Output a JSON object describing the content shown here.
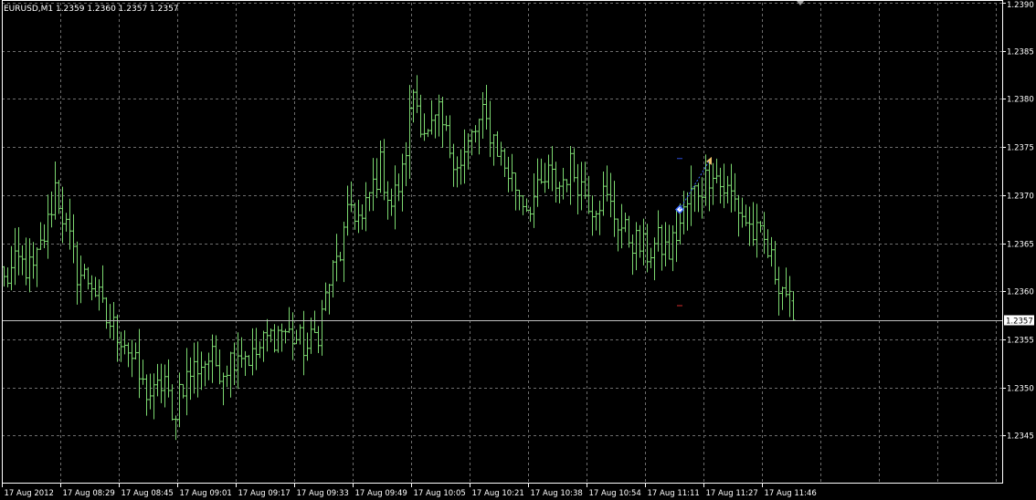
{
  "window": {
    "title": "EURUSD,M1  1.2359 1.2360 1.2357 1.2357"
  },
  "colors": {
    "background": "#000000",
    "grid": "#6e6e6e",
    "bars": "#7cd870",
    "text": "#ffffff",
    "current_line": "#c0c0c0"
  },
  "chart_data": {
    "type": "ohlc",
    "symbol": "EURUSD",
    "timeframe": "M1",
    "title": "EURUSD,M1  1.2359 1.2360 1.2357 1.2357",
    "last_ohlc": {
      "open": 1.2359,
      "high": 1.236,
      "low": 1.2357,
      "close": 1.2357
    },
    "current_price": 1.2357,
    "current_price_label": "1.2357",
    "ylim": [
      1.234,
      1.239
    ],
    "y_ticks": [
      "1.2390",
      "1.2385",
      "1.2380",
      "1.2375",
      "1.2370",
      "1.2365",
      "1.2360",
      "1.2355",
      "1.2350",
      "1.2345"
    ],
    "x_ticks": [
      "17 Aug 2012",
      "17 Aug 08:29",
      "17 Aug 08:45",
      "17 Aug 09:01",
      "17 Aug 09:17",
      "17 Aug 09:33",
      "17 Aug 09:49",
      "17 Aug 10:05",
      "17 Aug 10:21",
      "17 Aug 10:38",
      "17 Aug 10:54",
      "17 Aug 11:11",
      "17 Aug 11:27",
      "17 Aug 11:46"
    ],
    "grid": true,
    "bar_count": 217,
    "close_path": [
      [
        0,
        1.2361
      ],
      [
        4,
        1.2363
      ],
      [
        8,
        1.2362
      ],
      [
        12,
        1.2367
      ],
      [
        14,
        1.2371
      ],
      [
        16,
        1.2368
      ],
      [
        18,
        1.2365
      ],
      [
        20,
        1.2362
      ],
      [
        24,
        1.2361
      ],
      [
        28,
        1.2357
      ],
      [
        33,
        1.2355
      ],
      [
        36,
        1.2352
      ],
      [
        38,
        1.235
      ],
      [
        41,
        1.2349
      ],
      [
        44,
        1.2351
      ],
      [
        46,
        1.2346
      ],
      [
        48,
        1.235
      ],
      [
        52,
        1.2352
      ],
      [
        56,
        1.2353
      ],
      [
        60,
        1.2352
      ],
      [
        64,
        1.2354
      ],
      [
        68,
        1.2353
      ],
      [
        72,
        1.2355
      ],
      [
        76,
        1.2356
      ],
      [
        80,
        1.2355
      ],
      [
        83,
        1.2354
      ],
      [
        86,
        1.2356
      ],
      [
        89,
        1.2361
      ],
      [
        92,
        1.2364
      ],
      [
        95,
        1.2369
      ],
      [
        98,
        1.2367
      ],
      [
        100,
        1.237
      ],
      [
        103,
        1.2373
      ],
      [
        106,
        1.2369
      ],
      [
        109,
        1.2372
      ],
      [
        112,
        1.2381
      ],
      [
        114,
        1.2378
      ],
      [
        116,
        1.2376
      ],
      [
        119,
        1.2378
      ],
      [
        122,
        1.2375
      ],
      [
        125,
        1.2373
      ],
      [
        128,
        1.2376
      ],
      [
        131,
        1.2378
      ],
      [
        134,
        1.2376
      ],
      [
        137,
        1.2373
      ],
      [
        140,
        1.2371
      ],
      [
        143,
        1.2369
      ],
      [
        146,
        1.237
      ],
      [
        149,
        1.2372
      ],
      [
        152,
        1.2371
      ],
      [
        155,
        1.2373
      ],
      [
        158,
        1.2371
      ],
      [
        161,
        1.2369
      ],
      [
        164,
        1.237
      ],
      [
        167,
        1.2368
      ],
      [
        170,
        1.2366
      ],
      [
        173,
        1.2365
      ],
      [
        176,
        1.2364
      ],
      [
        179,
        1.2365
      ],
      [
        182,
        1.2364
      ],
      [
        185,
        1.2367
      ],
      [
        188,
        1.237
      ],
      [
        191,
        1.2371
      ],
      [
        194,
        1.2373
      ],
      [
        196,
        1.2371
      ],
      [
        199,
        1.237
      ],
      [
        202,
        1.2368
      ],
      [
        205,
        1.2366
      ],
      [
        208,
        1.2365
      ],
      [
        211,
        1.2362
      ],
      [
        214,
        1.236
      ],
      [
        216,
        1.2357
      ]
    ],
    "markers": [
      {
        "bar": 185,
        "price": 1.23685,
        "type": "open-marker",
        "color": "#3b6cff"
      },
      {
        "bar": 193,
        "price": 1.23735,
        "type": "close-marker",
        "color": "#f2c46e"
      },
      {
        "bar": 185,
        "price": 1.23738,
        "type": "dash",
        "color": "#2b4bd4"
      },
      {
        "bar": 185,
        "price": 1.23585,
        "type": "dash",
        "color": "#d42b2b"
      }
    ]
  }
}
